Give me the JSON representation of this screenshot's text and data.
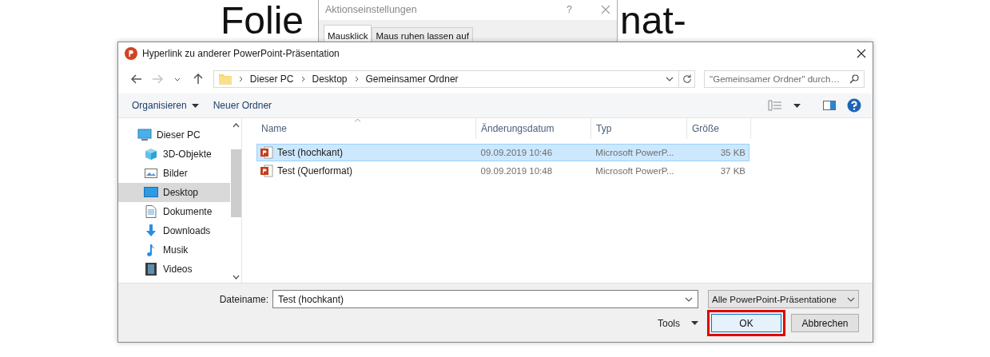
{
  "slide": {
    "title_parts": [
      "Folie",
      "nat-"
    ]
  },
  "behind_dialog": {
    "title": "Aktionseinstellungen",
    "help": "?",
    "tabs": [
      {
        "label": "Mausklick",
        "selected": true
      },
      {
        "label": "Maus ruhen lassen auf",
        "selected": false
      }
    ]
  },
  "dialog": {
    "title": "Hyperlink zu anderer PowerPoint-Präsentation",
    "nav_buttons": [
      {
        "kind": "back",
        "disabled": false
      },
      {
        "kind": "forward",
        "disabled": true
      },
      {
        "kind": "recent",
        "disabled": false
      },
      {
        "kind": "up",
        "disabled": false
      }
    ],
    "breadcrumbs": [
      "Dieser PC",
      "Desktop",
      "Gemeinsamer Ordner"
    ],
    "search": {
      "placeholder": "\"Gemeinsamer Ordner\" durch…"
    },
    "toolbar": [
      {
        "label": "Organisieren",
        "kind": "menu"
      },
      {
        "label": "Neuer Ordner",
        "kind": "button"
      }
    ],
    "sidebar": {
      "items": [
        {
          "label": "Dieser PC",
          "kind": "pc",
          "selected": false
        },
        {
          "label": "3D-Objekte",
          "kind": "objects3d",
          "selected": false
        },
        {
          "label": "Bilder",
          "kind": "pictures",
          "selected": false
        },
        {
          "label": "Desktop",
          "kind": "desktop",
          "selected": true
        },
        {
          "label": "Dokumente",
          "kind": "documents",
          "selected": false
        },
        {
          "label": "Downloads",
          "kind": "downloads",
          "selected": false
        },
        {
          "label": "Musik",
          "kind": "music",
          "selected": false
        },
        {
          "label": "Videos",
          "kind": "videos",
          "selected": false
        }
      ]
    },
    "columns": [
      "Name",
      "Änderungsdatum",
      "Typ",
      "Größe"
    ],
    "files": [
      {
        "name": "Test (hochkant)",
        "modified": "09.09.2019 10:46",
        "type": "Microsoft PowerP...",
        "size": "35 KB",
        "selected": true
      },
      {
        "name": "Test (Querformat)",
        "modified": "09.09.2019 10:48",
        "type": "Microsoft PowerP...",
        "size": "37 KB",
        "selected": false
      }
    ],
    "filename": {
      "label": "Dateiname:",
      "value": "Test (hochkant)"
    },
    "filter": {
      "value": "Alle PowerPoint-Präsentatione"
    },
    "tools": {
      "label": "Tools"
    },
    "buttons": [
      {
        "label": "OK",
        "default": true,
        "highlighted": true
      },
      {
        "label": "Abbrechen",
        "default": false,
        "highlighted": false
      }
    ]
  }
}
